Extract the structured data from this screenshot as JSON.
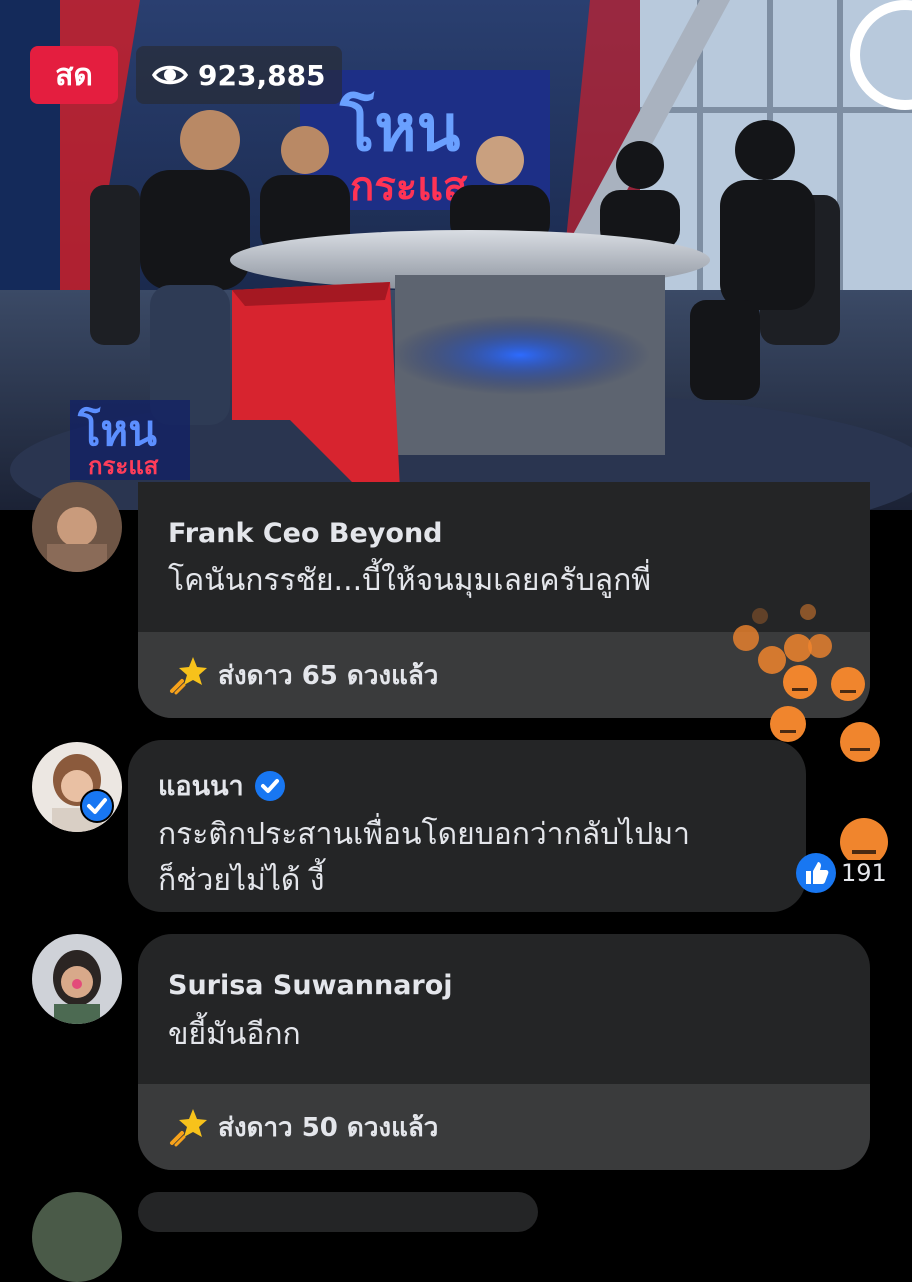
{
  "video": {
    "live_label": "สด",
    "viewer_count": "923,885",
    "eye_icon": "eye-icon",
    "logo_text": "โหน กระแส"
  },
  "comments": [
    {
      "author": "Frank Ceo Beyond",
      "text": "โคนันกรรชัย...บี้ให้จนมุมเลยครับลูกพี่",
      "stars_label": "ส่งดาว 65 ดวงแล้ว"
    },
    {
      "author": "แอนนา",
      "verified": true,
      "text_line1": "กระติกประสานเพื่อนโดยบอกว่ากลับไปมา",
      "text_line2": "ก็ช่วยไม่ได้ งี้",
      "like_count": "191"
    },
    {
      "author": "Surisa Suwannaroj",
      "text": "ขยี้มันอีกก",
      "stars_label": "ส่งดาว 50 ดวงแล้ว"
    }
  ],
  "colors": {
    "live_red": "#e41e3f",
    "bubble_bg": "#242526",
    "star_strip_bg": "#3a3b3c",
    "verified_blue": "#1877f2",
    "angry_orange": "#f0852d"
  }
}
